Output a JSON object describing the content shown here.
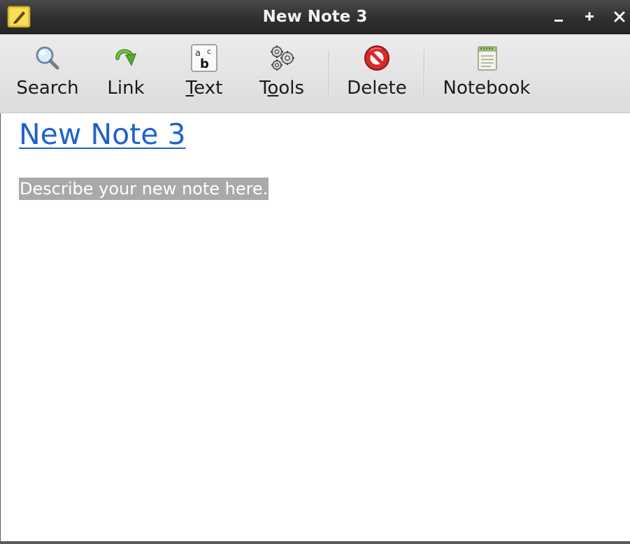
{
  "window": {
    "title": "New Note 3",
    "icon": "note-pad-icon",
    "controls": {
      "minimize": "–",
      "maximize": "+",
      "close": "×"
    }
  },
  "toolbar": {
    "items": [
      {
        "label": "Search",
        "icon": "magnifier-icon"
      },
      {
        "label": "Link",
        "icon": "green-arrow-icon"
      },
      {
        "label": "Text",
        "icon": "text-style-icon",
        "mnemonic": "T",
        "rest": "ext"
      },
      {
        "label": "Tools",
        "icon": "gears-icon",
        "pre": "T",
        "mnemonic": "o",
        "rest": "ols"
      },
      {
        "label": "Delete",
        "icon": "red-no-entry-icon"
      },
      {
        "label": "Notebook",
        "icon": "notebook-icon"
      }
    ]
  },
  "note": {
    "title": "New Note 3",
    "body": "Describe your new note here."
  },
  "colors": {
    "titlebar": "#2f2f2f",
    "toolbar": "#e3e3e3",
    "link": "#1f63c9",
    "selection": "#a9a9a9"
  }
}
